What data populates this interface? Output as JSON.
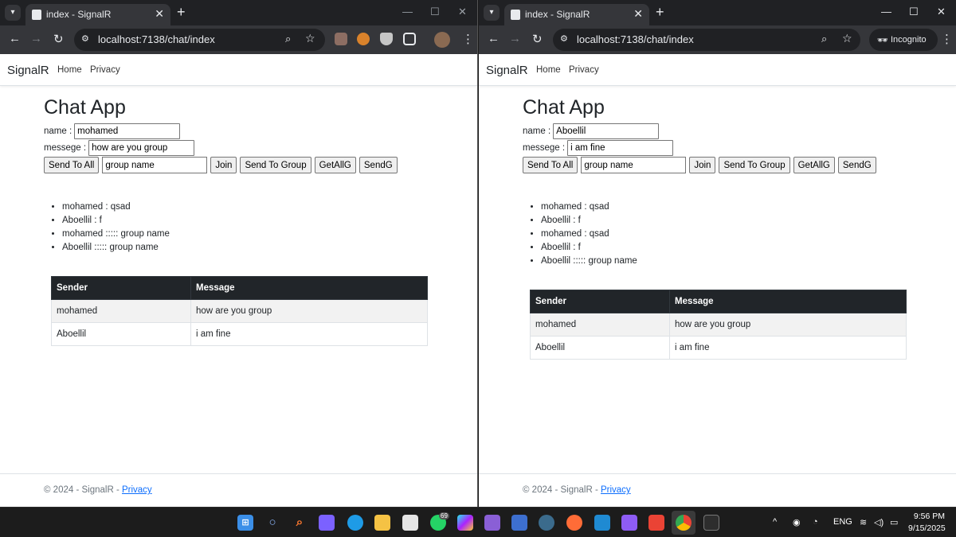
{
  "browser": {
    "tab_title": "index - SignalR",
    "tab_close": "✕",
    "new_tab": "+",
    "url": "localhost:7138/chat/index",
    "incognito_label": "Incognito",
    "window_controls": {
      "minimize": "—",
      "maximize": "☐",
      "close": "✕"
    }
  },
  "app": {
    "brand": "SignalR",
    "nav": {
      "home": "Home",
      "privacy": "Privacy"
    },
    "title": "Chat App",
    "name_label": "name :",
    "message_label": "messege :",
    "buttons": {
      "send_to_all": "Send To All",
      "join": "Join",
      "send_to_group": "Send To Group",
      "get_all_g": "GetAllG",
      "send_g": "SendG"
    },
    "table_headers": {
      "sender": "Sender",
      "message": "Message"
    },
    "footer": {
      "text": "© 2024 - SignalR -",
      "link": "Privacy"
    }
  },
  "left_window": {
    "name_value": "mohamed",
    "message_value": "how are you group",
    "group_value": "group name",
    "messages": [
      "mohamed : qsad",
      "Aboellil : f",
      "mohamed ::::: group name",
      "Aboellil ::::: group name"
    ],
    "rows": [
      {
        "sender": "mohamed",
        "message": "how are you group"
      },
      {
        "sender": "Aboellil",
        "message": "i am fine"
      }
    ]
  },
  "right_window": {
    "name_value": "Aboellil",
    "message_value": "i am fine",
    "group_value": "group name",
    "messages": [
      "mohamed : qsad",
      "Aboellil : f",
      "mohamed : qsad",
      "Aboellil : f",
      "Aboellil ::::: group name"
    ],
    "rows": [
      {
        "sender": "mohamed",
        "message": "how are you group"
      },
      {
        "sender": "Aboellil",
        "message": "i am fine"
      }
    ]
  },
  "taskbar": {
    "icons": [
      "windows-start-icon",
      "search-icon",
      "search-app-icon",
      "copilot-icon",
      "edge-icon",
      "file-explorer-icon",
      "store-icon",
      "whatsapp-icon",
      "webstorm-icon",
      "visual-studio-icon",
      "sourcetree-icon",
      "dbeaver-icon",
      "postman-icon",
      "vscode-icon",
      "obsidian-icon",
      "gmail-icon",
      "chrome-icon",
      "terminal-icon"
    ],
    "whatsapp_badge": "69",
    "language": "ENG",
    "time": "9:56 PM",
    "date": "9/15/2025"
  },
  "colors": {
    "chrome_dark": "#202124",
    "chrome_toolbar": "#35363a",
    "table_header": "#212529",
    "link": "#0d6efd"
  }
}
